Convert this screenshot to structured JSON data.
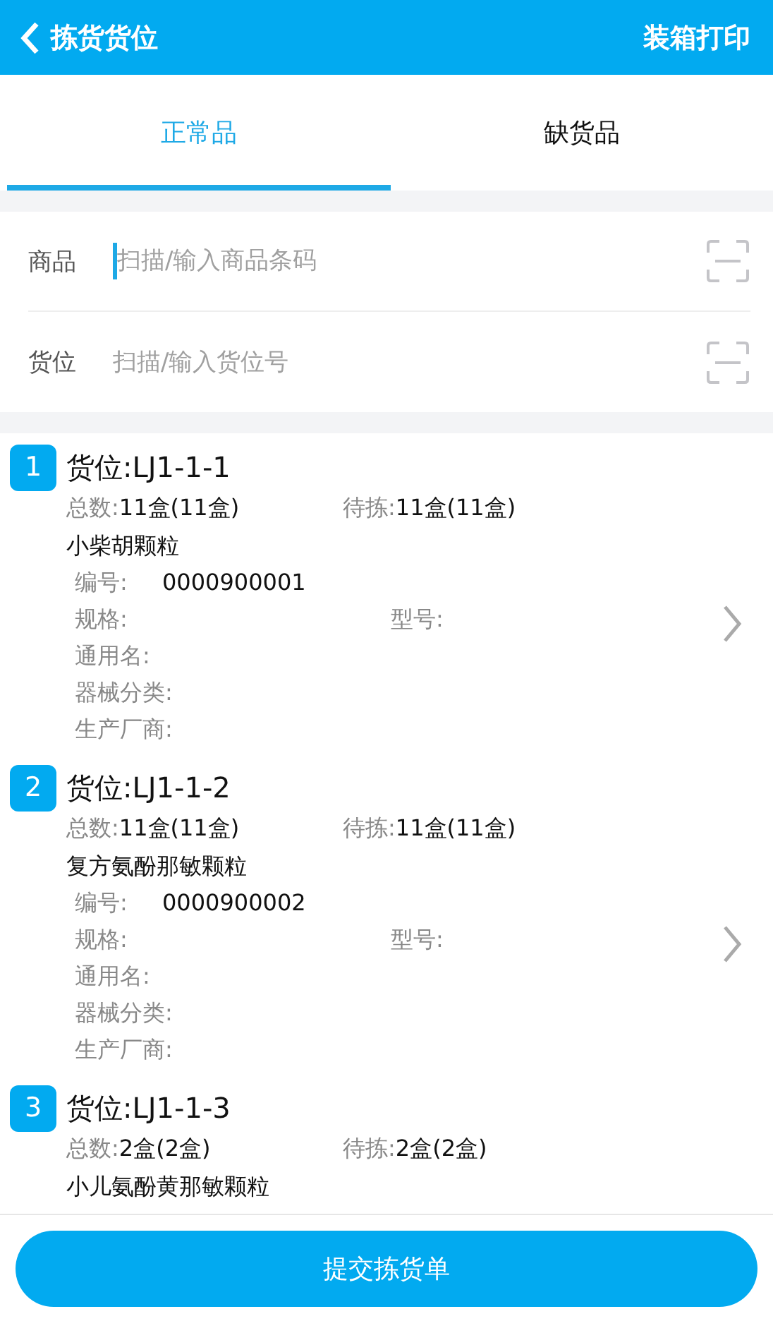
{
  "header": {
    "title": "拣货货位",
    "action": "装箱打印"
  },
  "tabs": [
    {
      "label": "正常品",
      "selected": true
    },
    {
      "label": "缺货品",
      "selected": false
    }
  ],
  "fields": [
    {
      "label": "商品",
      "placeholder": "扫描/输入商品条码",
      "focused": true
    },
    {
      "label": "货位",
      "placeholder": "扫描/输入货位号",
      "focused": false
    }
  ],
  "locations": [
    {
      "index": "1",
      "title": "货位:LJ1-1-1",
      "total_label": "总数:",
      "total": "11盒(11盒)",
      "pending_label": "待拣:",
      "pending": "11盒(11盒)",
      "product": "小柴胡颗粒",
      "code_label": "编号:",
      "code": "0000900001",
      "spec_label": "规格:",
      "model_label": "型号:",
      "details": [
        "通用名:",
        "器械分类:",
        "生产厂商:"
      ]
    },
    {
      "index": "2",
      "title": "货位:LJ1-1-2",
      "total_label": "总数:",
      "total": "11盒(11盒)",
      "pending_label": "待拣:",
      "pending": "11盒(11盒)",
      "product": "复方氨酚那敏颗粒",
      "code_label": "编号:",
      "code": "0000900002",
      "spec_label": "规格:",
      "model_label": "型号:",
      "details": [
        "通用名:",
        "器械分类:",
        "生产厂商:"
      ]
    },
    {
      "index": "3",
      "title": "货位:LJ1-1-3",
      "total_label": "总数:",
      "total": "2盒(2盒)",
      "pending_label": "待拣:",
      "pending": "2盒(2盒)",
      "product": "小儿氨酚黄那敏颗粒"
    }
  ],
  "submit": "提交拣货单"
}
